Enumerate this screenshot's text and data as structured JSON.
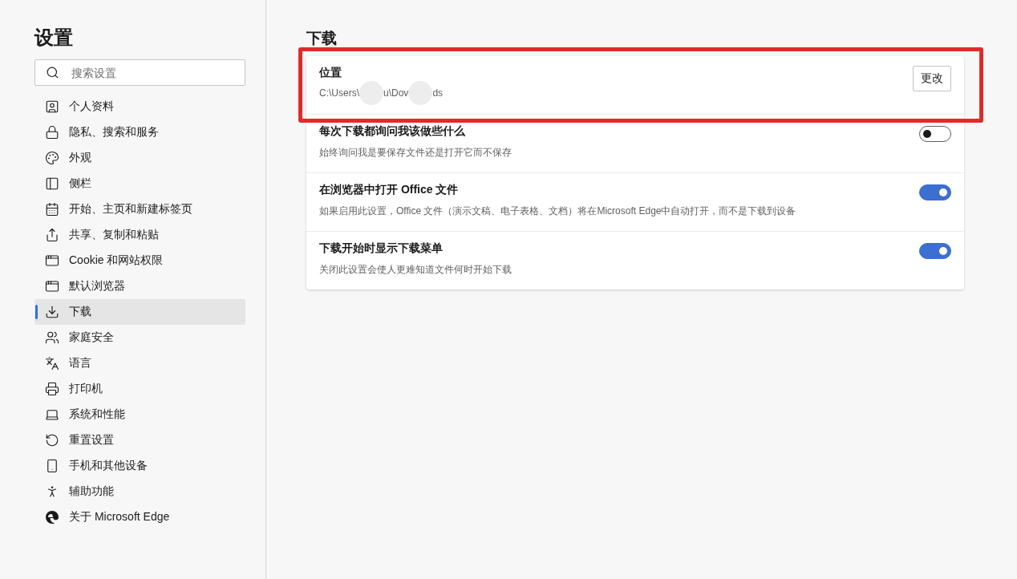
{
  "sidebar": {
    "title": "设置",
    "search": {
      "placeholder": "搜索设置"
    },
    "items": [
      {
        "label": "个人资料",
        "selected": false
      },
      {
        "label": "隐私、搜索和服务",
        "selected": false
      },
      {
        "label": "外观",
        "selected": false
      },
      {
        "label": "侧栏",
        "selected": false
      },
      {
        "label": "开始、主页和新建标签页",
        "selected": false
      },
      {
        "label": "共享、复制和粘贴",
        "selected": false
      },
      {
        "label": "Cookie 和网站权限",
        "selected": false
      },
      {
        "label": "默认浏览器",
        "selected": false
      },
      {
        "label": "下载",
        "selected": true
      },
      {
        "label": "家庭安全",
        "selected": false
      },
      {
        "label": "语言",
        "selected": false
      },
      {
        "label": "打印机",
        "selected": false
      },
      {
        "label": "系统和性能",
        "selected": false
      },
      {
        "label": "重置设置",
        "selected": false
      },
      {
        "label": "手机和其他设备",
        "selected": false
      },
      {
        "label": "辅助功能",
        "selected": false
      },
      {
        "label": "关于 Microsoft Edge",
        "selected": false
      }
    ]
  },
  "main": {
    "heading": "下载",
    "location": {
      "title": "位置",
      "path_parts": [
        "C:\\Users\\",
        "u\\Dov",
        "ds"
      ],
      "button": "更改",
      "highlighted": true
    },
    "settings": [
      {
        "title": "每次下载都询问我该做些什么",
        "description": "始终询问我是要保存文件还是打开它而不保存",
        "on": false
      },
      {
        "title": "在浏览器中打开 Office 文件",
        "description": "如果启用此设置，Office 文件（演示文稿、电子表格、文档）将在Microsoft Edge中自动打开，而不是下载到设备",
        "on": true
      },
      {
        "title": "下载开始时显示下载菜单",
        "description": "关闭此设置会使人更难知道文件何时开始下载",
        "on": true
      }
    ]
  }
}
